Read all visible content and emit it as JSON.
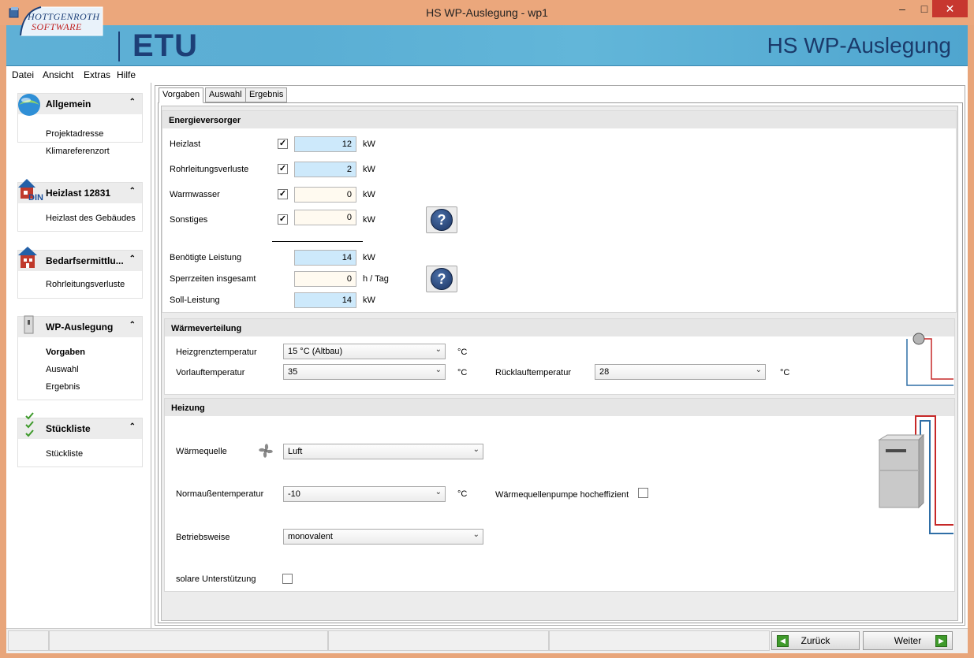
{
  "window": {
    "title": "HS WP-Auslegung - wp1",
    "minimize": "–",
    "maximize": "□",
    "close": "✕"
  },
  "banner": {
    "logo_line1": "HOTTGENROTH",
    "logo_line2": "SOFTWARE",
    "product": "ETU",
    "title": "HS WP-Auslegung"
  },
  "menu": [
    "Datei",
    "Ansicht",
    "Extras",
    "Hilfe"
  ],
  "sidebar": {
    "groups": [
      {
        "title": "Allgemein",
        "icon": "globe-icon",
        "items": [
          "Projektadresse",
          "Klimareferenzort"
        ]
      },
      {
        "title": "Heizlast 12831",
        "icon": "din-house-icon",
        "icon_text": "DIN",
        "items": [
          "Heizlast des Gebäudes"
        ]
      },
      {
        "title": "Bedarfsermittlu...",
        "icon": "house-icon",
        "items": [
          "Rohrleitungsverluste"
        ]
      },
      {
        "title": "WP-Auslegung",
        "icon": "heatpump-icon",
        "items": [
          "Vorgaben",
          "Auswahl",
          "Ergebnis"
        ],
        "active_item": "Vorgaben"
      },
      {
        "title": "Stückliste",
        "icon": "checklist-icon",
        "items": [
          "Stückliste"
        ]
      }
    ],
    "chevron": "⌃"
  },
  "tabs": [
    "Vorgaben",
    "Auswahl",
    "Ergebnis"
  ],
  "energie": {
    "title": "Energieversorger",
    "rows": [
      {
        "label": "Heizlast",
        "checked": true,
        "value": "12",
        "unit": "kW"
      },
      {
        "label": "Rohrleitungsverluste",
        "checked": true,
        "value": "2",
        "unit": "kW"
      },
      {
        "label": "Warmwasser",
        "checked": true,
        "value": "0",
        "unit": "kW"
      },
      {
        "label": "Sonstiges",
        "checked": true,
        "value": "0",
        "unit": "kW"
      }
    ],
    "benoetigt": {
      "label": "Benötigte Leistung",
      "value": "14",
      "unit": "kW"
    },
    "sperrzeiten": {
      "label": "Sperrzeiten insgesamt",
      "value": "0",
      "unit": "h / Tag"
    },
    "soll": {
      "label": "Soll-Leistung",
      "value": "14",
      "unit": "kW"
    },
    "help_label": "?"
  },
  "waerme": {
    "title": "Wärmeverteilung",
    "heizgrenz_label": "Heizgrenztemperatur",
    "heizgrenz_value": "15 °C (Altbau)",
    "vorlauf_label": "Vorlauftemperatur",
    "vorlauf_value": "35",
    "ruecklauf_label": "Rücklauftemperatur",
    "ruecklauf_value": "28",
    "unit": "°C"
  },
  "heizung": {
    "title": "Heizung",
    "quelle_label": "Wärmequelle",
    "quelle_value": "Luft",
    "norm_label": "Normaußentemperatur",
    "norm_value": "-10",
    "norm_unit": "°C",
    "pumpe_label": "Wärmequellenpumpe hocheffizient",
    "betrieb_label": "Betriebsweise",
    "betrieb_value": "monovalent",
    "solar_label": "solare Unterstützung"
  },
  "nav": {
    "back": "Zurück",
    "next": "Weiter"
  },
  "check_glyph": "✓",
  "dropdown_glyph": "⌄",
  "colors": {
    "banner": "#5aaed4",
    "titlebar": "#eba77c",
    "field_blue": "#cde9fb",
    "field_cream": "#fffaf0",
    "close_button": "#c7372f"
  }
}
